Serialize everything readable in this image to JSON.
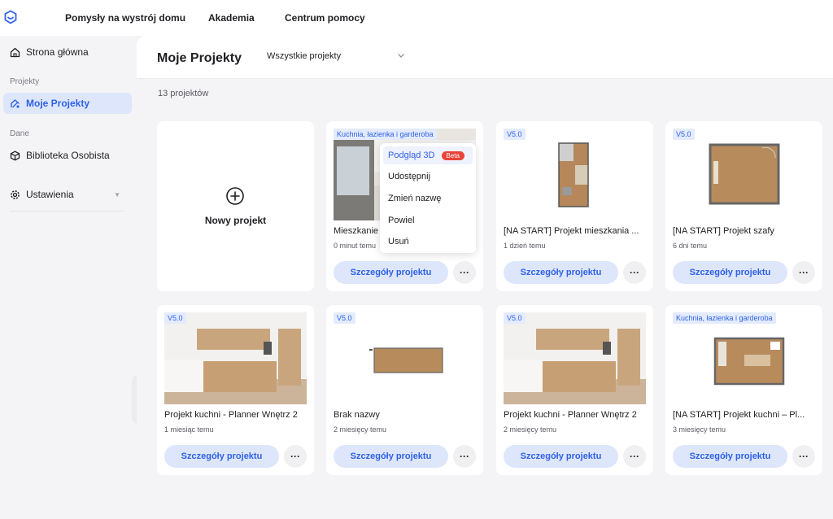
{
  "topnav": {
    "items": [
      "Pomysły na wystrój domu",
      "Akademia",
      "Centrum pomocy"
    ]
  },
  "sidebar": {
    "home": "Strona główna",
    "section_projects": "Projekty",
    "my_projects": "Moje Projekty",
    "section_data": "Dane",
    "library": "Biblioteka Osobista",
    "settings": "Ustawienia"
  },
  "main": {
    "title": "Moje Projekty",
    "filter_value": "Wszystkie projekty",
    "count": "13 projektów",
    "new_project": "Nowy projekt",
    "details_label": "Szczegóły projektu",
    "more_label": "···"
  },
  "projects": [
    {
      "badge": "Kuchnia, łazienka i garderoba",
      "title": "Mieszkanie",
      "time": "0 minut temu"
    },
    {
      "badge": "V5.0",
      "title": "[NA START] Projekt mieszkania ...",
      "time": "1 dzień temu"
    },
    {
      "badge": "V5.0",
      "title": "[NA START] Projekt szafy",
      "time": "6 dni temu"
    },
    {
      "badge": "V5.0",
      "title": "Projekt kuchni - Planner Wnętrz 2",
      "time": "1 miesiąc temu"
    },
    {
      "badge": "V5.0",
      "title": "Brak nazwy",
      "time": "2 miesięcy temu"
    },
    {
      "badge": "V5.0",
      "title": "Projekt kuchni - Planner Wnętrz 2",
      "time": "2 miesięcy temu"
    },
    {
      "badge": "Kuchnia, łazienka i garderoba",
      "title": "[NA START] Projekt kuchni – Pl...",
      "time": "3 miesięcy temu"
    }
  ],
  "context_menu": {
    "items": [
      "Podgląd 3D",
      "Udostępnij",
      "Zmień nazwę",
      "Powiel",
      "Usuń"
    ],
    "beta_badge": "Beta"
  },
  "colors": {
    "accent": "#2f62e8",
    "accent_light": "#dee6fb",
    "beta": "#e8443a",
    "background": "#f4f4f6"
  }
}
